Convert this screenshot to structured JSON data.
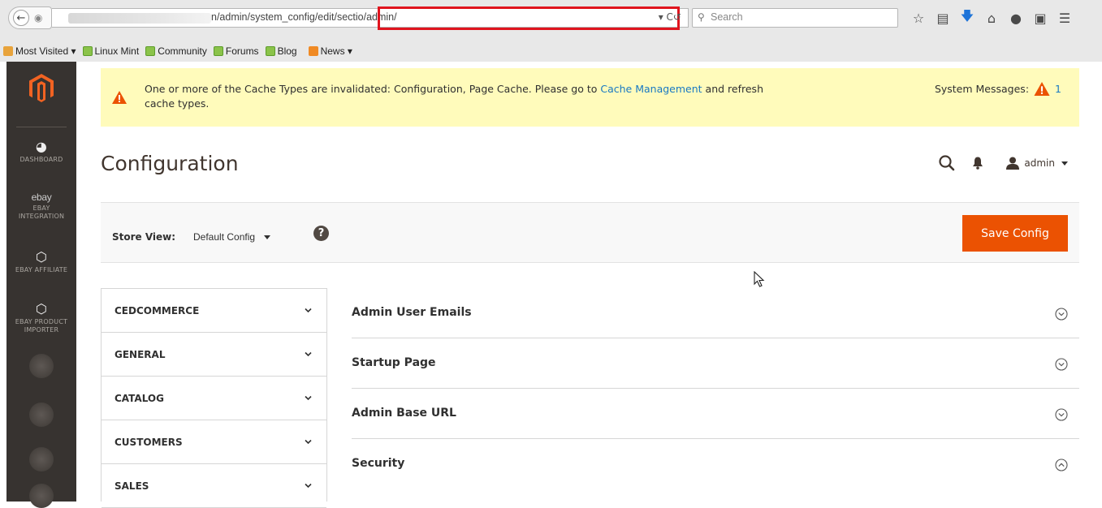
{
  "browser": {
    "url_text": "n/admin/system_config/edit/sectio",
    "url_highlighted": "/admin/",
    "search_placeholder": "Search",
    "bookmarks": [
      {
        "label": "Most Visited ▾",
        "icon": "folder"
      },
      {
        "label": "Linux Mint",
        "icon": "mint"
      },
      {
        "label": "Community",
        "icon": "mint"
      },
      {
        "label": "Forums",
        "icon": "mint"
      },
      {
        "label": "Blog",
        "icon": "mint"
      },
      {
        "label": "News ▾",
        "icon": "rss"
      }
    ]
  },
  "sidebar": {
    "items": [
      {
        "label": "DASHBOARD",
        "icon": "dashboard-icon"
      },
      {
        "logo_text": "ebay",
        "label": "EBAY INTEGRATION",
        "icon": "ebay-logo"
      },
      {
        "label": "EBAY AFFILIATE",
        "icon": "hexagon-icon"
      },
      {
        "label": "EBAY PRODUCT IMPORTER",
        "icon": "hexagon-icon"
      }
    ]
  },
  "notice": {
    "text_before": "One or more of the Cache Types are invalidated: Configuration, Page Cache. Please go to ",
    "link_text": "Cache Management",
    "text_after": " and refresh cache types.",
    "system_messages_label": "System Messages:",
    "system_messages_count": "1"
  },
  "header": {
    "title": "Configuration",
    "user_name": "admin"
  },
  "store_bar": {
    "label": "Store View:",
    "selected": "Default Config",
    "help": "?",
    "save_label": "Save Config"
  },
  "tabs": [
    "CEDCOMMERCE",
    "GENERAL",
    "CATALOG",
    "CUSTOMERS",
    "SALES"
  ],
  "sections": [
    {
      "title": "Admin User Emails",
      "state": "collapsed"
    },
    {
      "title": "Startup Page",
      "state": "collapsed"
    },
    {
      "title": "Admin Base URL",
      "state": "collapsed"
    },
    {
      "title": "Security",
      "state": "expanded"
    }
  ],
  "colors": {
    "accent": "#eb5202",
    "sidebar_bg": "#373330",
    "notice_bg": "#fffbbb",
    "link": "#1979c3",
    "highlight_border": "#e0141e"
  }
}
